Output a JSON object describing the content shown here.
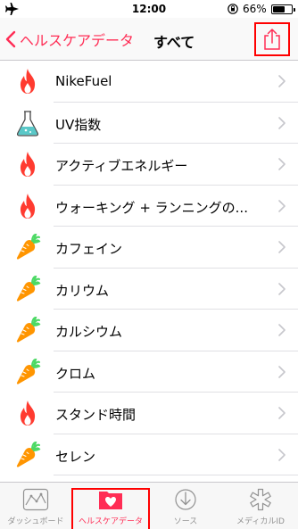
{
  "status_bar": {
    "time": "12:00",
    "battery_percent": "66%",
    "battery_level": 0.66,
    "icons": [
      "airplane-icon",
      "orientation-lock-icon",
      "battery-icon"
    ]
  },
  "nav": {
    "back_label": "ヘルスケアデータ",
    "title": "すべて",
    "share_icon": "share-icon"
  },
  "colors": {
    "accent": "#ff2d55",
    "flame": "#ff3b30",
    "carrot": "#ff9500",
    "leaf": "#4cd964",
    "flask": "#5ac8c8",
    "highlight": "#ff0000"
  },
  "items": [
    {
      "label": "NikeFuel",
      "icon": "flame-icon"
    },
    {
      "label": "UV指数",
      "icon": "flask-icon"
    },
    {
      "label": "アクティブエネルギー",
      "icon": "flame-icon"
    },
    {
      "label": "ウォーキング + ランニングの...",
      "icon": "flame-icon"
    },
    {
      "label": "カフェイン",
      "icon": "carrot-icon"
    },
    {
      "label": "カリウム",
      "icon": "carrot-icon"
    },
    {
      "label": "カルシウム",
      "icon": "carrot-icon"
    },
    {
      "label": "クロム",
      "icon": "carrot-icon"
    },
    {
      "label": "スタンド時間",
      "icon": "flame-icon"
    },
    {
      "label": "セレン",
      "icon": "carrot-icon"
    }
  ],
  "tabs": [
    {
      "label": "ダッシュボード",
      "icon": "dashboard-icon",
      "active": false
    },
    {
      "label": "ヘルスケアデータ",
      "icon": "health-data-icon",
      "active": true
    },
    {
      "label": "ソース",
      "icon": "sources-icon",
      "active": false
    },
    {
      "label": "メディカルID",
      "icon": "medical-id-icon",
      "active": false
    }
  ]
}
